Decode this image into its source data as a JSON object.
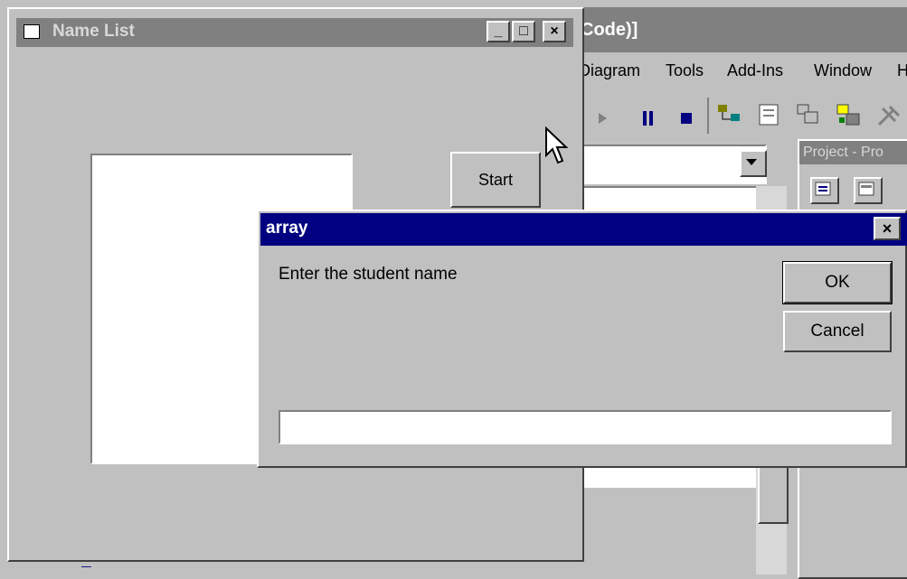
{
  "ide": {
    "title_fragment": "Code)]",
    "menu": [
      "Diagram",
      "Tools",
      "Add-Ins",
      "Window",
      "H"
    ],
    "project_panel_title": "Project - Pro",
    "code_fragment": "         _"
  },
  "form": {
    "title": "Name List",
    "start_label": "Start",
    "caption_buttons": {
      "minimize": "_",
      "maximize": "□",
      "close": "×"
    }
  },
  "dialog": {
    "title": "array",
    "close_glyph": "×",
    "prompt": "Enter the student name",
    "ok_label": "OK",
    "cancel_label": "Cancel",
    "input_value": "",
    "colors": {
      "active_title": "#000080",
      "inactive_title": "#808080",
      "face": "#c0c0c0"
    }
  }
}
